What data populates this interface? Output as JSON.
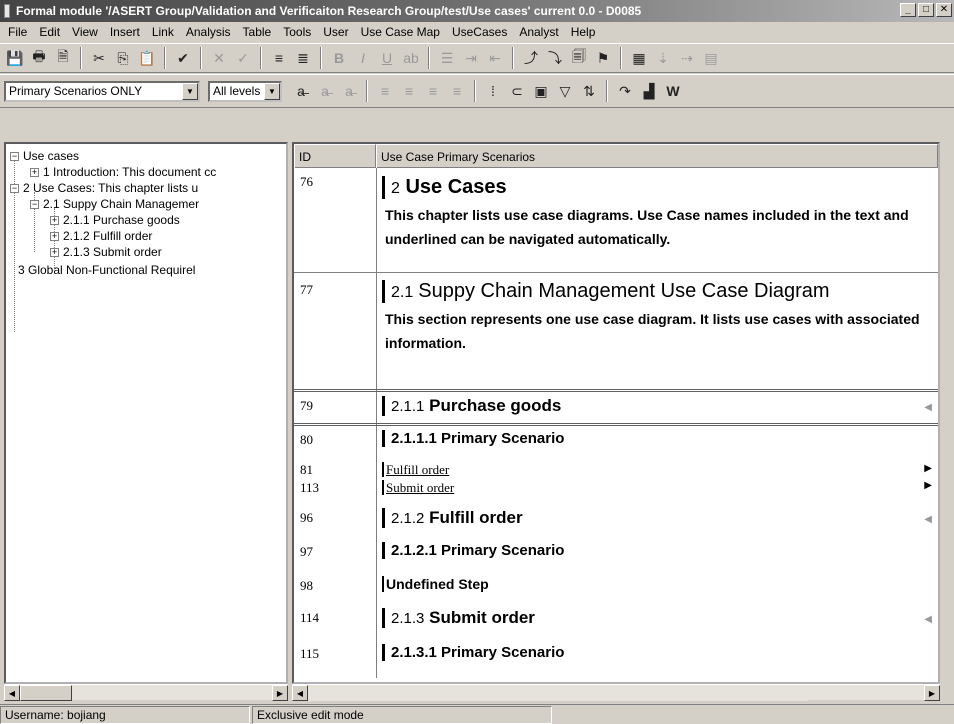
{
  "window": {
    "title": "Formal module '/ASERT Group/Validation and Verificaiton Research Group/test/Use cases' current 0.0 - D0085"
  },
  "menu": [
    "File",
    "Edit",
    "View",
    "Insert",
    "Link",
    "Analysis",
    "Table",
    "Tools",
    "User",
    "Use Case Map",
    "UseCases",
    "Analyst",
    "Help"
  ],
  "filters": {
    "view": "Primary Scenarios ONLY",
    "levels": "All levels"
  },
  "tree": {
    "root": "Use cases",
    "items": [
      {
        "label": "1 Introduction: This document cc"
      },
      {
        "label": "2 Use Cases: This chapter lists u"
      },
      {
        "label": "2.1 Suppy Chain Managemer"
      },
      {
        "label": "2.1.1 Purchase goods"
      },
      {
        "label": "2.1.2 Fulfill order"
      },
      {
        "label": "2.1.3 Submit order"
      },
      {
        "label": "3 Global Non-Functional Requirel"
      }
    ]
  },
  "grid": {
    "id_header": "ID",
    "content_header": "Use Case Primary Scenarios",
    "rows": [
      {
        "id": "76",
        "heading_num": "2",
        "heading": "Use Cases",
        "text": "This chapter lists use case diagrams. Use Case names included in the text and underlined can be navigated automatically."
      },
      {
        "id": "77",
        "heading_num": "2.1",
        "heading": "Suppy Chain Management Use Case Diagram",
        "text": "This section represents one use case diagram. It lists use cases with associated information."
      },
      {
        "id": "79",
        "heading_num": "2.1.1",
        "heading": "Purchase goods"
      },
      {
        "id": "80",
        "heading": "2.1.1.1 Primary Scenario"
      },
      {
        "id": "81",
        "link": "Fulfill order"
      },
      {
        "id": "113",
        "link": "Submit order"
      },
      {
        "id": "96",
        "heading_num": "2.1.2",
        "heading": "Fulfill order"
      },
      {
        "id": "97",
        "heading": "2.1.2.1 Primary Scenario"
      },
      {
        "id": "98",
        "heading": "Undefined Step"
      },
      {
        "id": "114",
        "heading_num": "2.1.3",
        "heading": "Submit order"
      },
      {
        "id": "115",
        "heading": "2.1.3.1 Primary Scenario"
      }
    ]
  },
  "status": {
    "user": "Username: bojiang",
    "mode": "Exclusive edit mode"
  }
}
